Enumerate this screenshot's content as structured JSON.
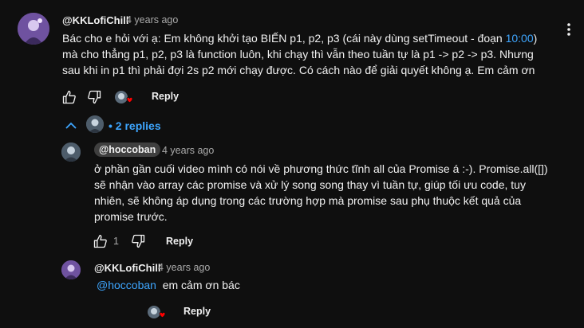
{
  "comment": {
    "author": "@KKLofiChill",
    "time": "4 years ago",
    "text_before_link": "Bác cho e hỏi với ạ: Em không khởi tạo BIẾN p1, p2, p3 (cái này dùng setTimeout - đoạn ",
    "timestamp_link": "10:00",
    "text_after_link": ")  mà cho thẳng p1, p2, p3 là function luôn, khi chạy thì vẫn theo tuần tự là p1 -> p2 -> p3. Nhưng sau khi in p1 thì phải đợi 2s p2 mới chạy được. Có cách nào để  giải quyết không ạ. Em cảm ơn",
    "reply_label": "Reply"
  },
  "replies_toggle": {
    "label": "2 replies"
  },
  "replies": [
    {
      "author": "@hoccoban",
      "time": "4 years ago",
      "text": "ở phần gần cuối video mình có nói về phương thức tĩnh all của Promise á :-). Promise.all([]) sẽ nhận vào array các promise và xử lý song song thay vì tuần tự, giúp tối ưu code, tuy nhiên, sẽ không áp dụng trong các trường hợp mà promise sau phụ thuộc kết quả của promise trước.",
      "like_count": "1",
      "reply_label": "Reply"
    },
    {
      "author": "@KKLofiChill",
      "time": "4 years ago",
      "mention": "@hoccoban",
      "text": "em cảm ơn bác",
      "reply_label": "Reply"
    }
  ],
  "colors": {
    "link": "#3ea6ff",
    "heart": "#ff0000",
    "background": "#0f0f0f"
  }
}
